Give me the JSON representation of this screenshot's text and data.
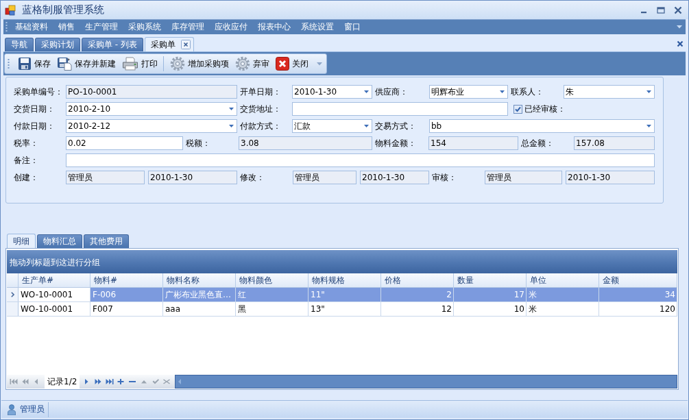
{
  "window": {
    "title": "蓝格制服管理系统"
  },
  "menu": [
    "基础资料",
    "销售",
    "生产管理",
    "采购系统",
    "库存管理",
    "应收应付",
    "报表中心",
    "系统设置",
    "窗口"
  ],
  "document_tabs": [
    {
      "label": "导航",
      "selected": false
    },
    {
      "label": "采购计划",
      "selected": false
    },
    {
      "label": "采购单 - 列表",
      "selected": false
    },
    {
      "label": "采购单",
      "selected": true
    }
  ],
  "toolbar": {
    "groups": [
      [
        "保存",
        "保存并新建",
        "打印"
      ],
      [
        "增加采购项",
        "弃审",
        "关闭"
      ]
    ]
  },
  "form": {
    "rows": [
      {
        "fields": [
          {
            "kind": "text",
            "label": "采购单编号：",
            "value": "PO-10-0001",
            "readonly": true,
            "dropdown": false
          },
          {
            "kind": "text",
            "label": "开单日期：",
            "value": "2010-1-30",
            "readonly": false,
            "dropdown": true
          },
          {
            "kind": "text",
            "label": "供应商：",
            "value": "明辉布业",
            "readonly": false,
            "dropdown": true
          },
          {
            "kind": "text",
            "label": "联系人：",
            "value": "朱",
            "readonly": false,
            "dropdown": true
          }
        ]
      },
      {
        "fields": [
          {
            "kind": "text",
            "label": "交货日期：",
            "value": "2010-2-10",
            "readonly": false,
            "dropdown": true
          },
          {
            "kind": "text",
            "label": "交货地址：",
            "readonly": false,
            "dropdown": false
          },
          {
            "kind": "checkbox",
            "label": "已经审核：",
            "checked": true
          }
        ]
      },
      {
        "fields": [
          {
            "kind": "text",
            "label": "付款日期：",
            "value": "2010-2-12",
            "readonly": false,
            "dropdown": true
          },
          {
            "kind": "text",
            "label": "付款方式：",
            "value": "汇款",
            "readonly": false,
            "dropdown": true
          },
          {
            "kind": "text",
            "label": "交易方式：",
            "value": "bb",
            "readonly": false,
            "dropdown": true
          }
        ]
      },
      {
        "fields": [
          {
            "kind": "text",
            "label": "税率：",
            "value": "0.02",
            "readonly": false,
            "dropdown": false
          },
          {
            "kind": "text",
            "label": "税额：",
            "value": "3.08",
            "readonly": true,
            "dropdown": false
          },
          {
            "kind": "text",
            "label": "物料金额：",
            "value": "154",
            "readonly": true,
            "dropdown": false
          },
          {
            "kind": "text",
            "label": "总金额：",
            "value": "157.08",
            "readonly": true,
            "dropdown": false
          }
        ]
      },
      {
        "fields": [
          {
            "kind": "text",
            "label": "备注：",
            "readonly": false,
            "dropdown": false
          }
        ]
      },
      {
        "fields": [
          {
            "kind": "text",
            "label": "创建：",
            "value": "管理员",
            "readonly": true,
            "dropdown": false
          },
          {
            "kind": "text",
            "value": "2010-1-30",
            "readonly": true,
            "dropdown": false
          },
          {
            "kind": "text",
            "label": "修改：",
            "value": "管理员",
            "readonly": true,
            "dropdown": false
          },
          {
            "kind": "text",
            "value": "2010-1-30",
            "readonly": true,
            "dropdown": false
          },
          {
            "kind": "text",
            "label": "审核：",
            "value": "管理员",
            "readonly": true,
            "dropdown": false
          },
          {
            "kind": "text",
            "value": "2010-1-30",
            "readonly": true,
            "dropdown": false
          }
        ]
      }
    ]
  },
  "detail_tabs": [
    {
      "label": "明细",
      "selected": true
    },
    {
      "label": "物料汇总",
      "selected": false
    },
    {
      "label": "其他费用",
      "selected": false
    }
  ],
  "grid": {
    "group_panel": "拖动列标题到这进行分组",
    "columns": [
      {
        "label": "生产单#",
        "numeric": false
      },
      {
        "label": "物料#",
        "numeric": false
      },
      {
        "label": "物料名称",
        "numeric": false
      },
      {
        "label": "物料颜色",
        "numeric": false
      },
      {
        "label": "物料规格",
        "numeric": false
      },
      {
        "label": "价格",
        "numeric": true
      },
      {
        "label": "数量",
        "numeric": true
      },
      {
        "label": "单位",
        "numeric": false
      },
      {
        "label": "金额",
        "numeric": true
      }
    ],
    "rows": [
      {
        "selected": true,
        "cells": [
          {
            "text": "WO-10-0001",
            "focused": true
          },
          {
            "text": "F-006",
            "focused": false
          },
          {
            "text": "广彬布业黑色直…",
            "focused": false
          },
          {
            "text": "红",
            "focused": false
          },
          {
            "text": "11\"",
            "focused": false
          },
          {
            "text": "2",
            "focused": false
          },
          {
            "text": "17",
            "focused": false
          },
          {
            "text": "米",
            "focused": false
          },
          {
            "text": "34",
            "focused": false
          }
        ]
      },
      {
        "selected": false,
        "cells": [
          {
            "text": "WO-10-0001",
            "focused": false
          },
          {
            "text": "F007",
            "focused": false
          },
          {
            "text": "aaa",
            "focused": false
          },
          {
            "text": "黑",
            "focused": false
          },
          {
            "text": "13\"",
            "focused": false
          },
          {
            "text": "12",
            "focused": false
          },
          {
            "text": "10",
            "focused": false
          },
          {
            "text": "米",
            "focused": false
          },
          {
            "text": "120",
            "focused": false
          }
        ]
      }
    ],
    "navigator": {
      "before": [
        {
          "kind": "first",
          "disabled": true
        },
        {
          "kind": "prev_page",
          "disabled": true
        },
        {
          "kind": "prev",
          "disabled": true
        }
      ],
      "record": "记录1/2",
      "after": [
        {
          "kind": "next",
          "disabled": false
        },
        {
          "kind": "next_page",
          "disabled": false
        },
        {
          "kind": "last",
          "disabled": false
        },
        {
          "kind": "append",
          "disabled": false
        },
        {
          "kind": "remove",
          "disabled": false
        },
        {
          "kind": "edit",
          "disabled": true
        },
        {
          "kind": "end_edit",
          "disabled": true
        },
        {
          "kind": "cancel_edit",
          "disabled": true
        }
      ]
    }
  },
  "status_bar": {
    "user": "管理员"
  }
}
